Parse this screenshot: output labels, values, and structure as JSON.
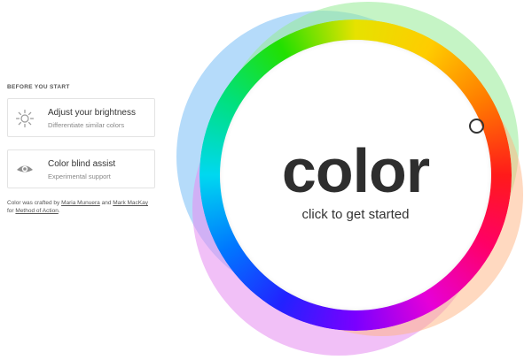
{
  "sidebar": {
    "section_label": "BEFORE YOU START",
    "options": [
      {
        "title": "Adjust your brightness",
        "subtitle": "Differentiate similar colors",
        "icon": "sun-icon"
      },
      {
        "title": "Color blind assist",
        "subtitle": "Experimental support",
        "icon": "eye-icon"
      }
    ],
    "credits": {
      "prefix": "Color was crafted by",
      "author1": "Maria Munuera",
      "and": "and",
      "author2": "Mark MacKay",
      "for": "for",
      "org": "Method of Action",
      "suffix": "."
    }
  },
  "wheel": {
    "title": "color",
    "subtitle": "click to get started",
    "handle_icon": "picker-handle-ring"
  },
  "colors": {
    "text_dark": "#2e2e2e",
    "card_border": "#e3e3e3"
  }
}
